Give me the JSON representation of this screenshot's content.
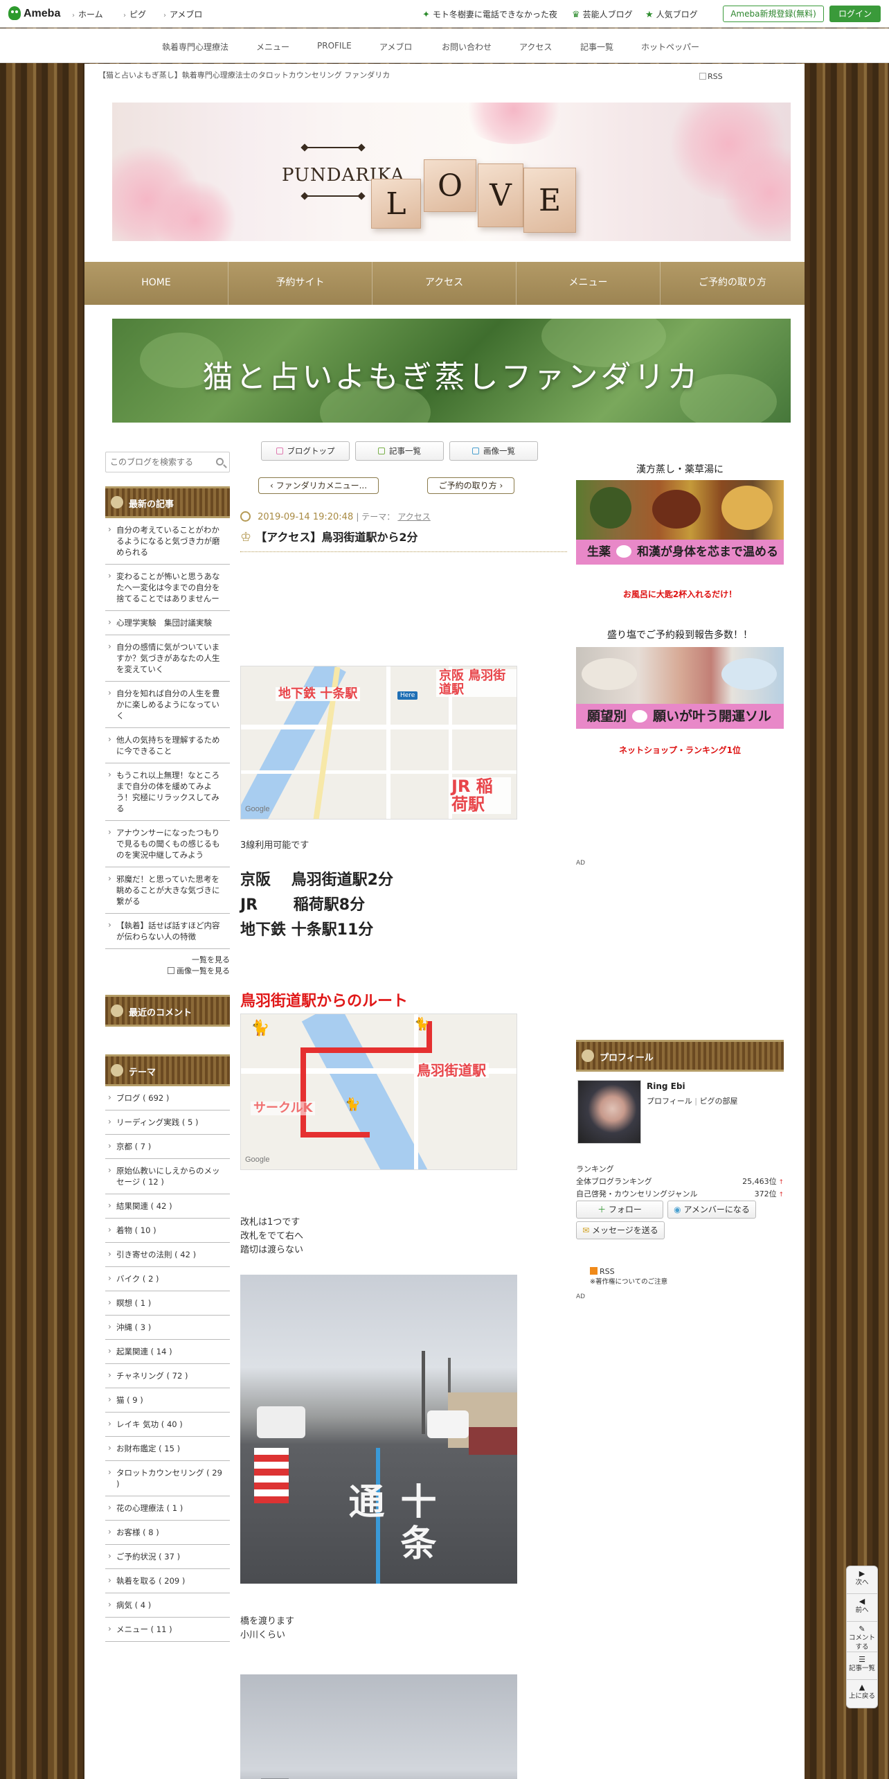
{
  "topbar": {
    "logo": "Ameba",
    "nav": [
      "ホーム",
      "ピグ",
      "アメブロ"
    ],
    "links": [
      "モト冬樹妻に電話できなかった夜",
      "芸能人ブログ",
      "人気ブログ"
    ],
    "register": "Ameba新規登録(無料)",
    "login": "ログイン"
  },
  "gnav": [
    "執着専門心理療法",
    "メニュー",
    "PROFILE",
    "アメブロ",
    "お問い合わせ",
    "アクセス",
    "記事一覧",
    "ホットペッパー"
  ],
  "header": {
    "title": "【猫と占いよもぎ蒸し】執着専門心理療法士のタロットカウンセリング ファンダリカ",
    "rss": "RSS",
    "brand": "PUNDARIKA",
    "love": [
      "L",
      "O",
      "V",
      "E"
    ]
  },
  "menubar": [
    "HOME",
    "予約サイト",
    "アクセス",
    "メニュー",
    "ご予約の取り方"
  ],
  "banner2": "猫と占いよもぎ蒸しファンダリカ",
  "left": {
    "search_placeholder": "このブログを検索する",
    "latest_heading": "最新の記事",
    "latest": [
      "自分の考えていることがわかるようになると気づき力が磨められる",
      "変わることが怖いと思うあなたへ一変化は今までの自分を捨てることではありませんー",
      "心理学実験　集団討議実験",
      "自分の感情に気がついていますか？気づきがあなたの人生を変えていく",
      "自分を知れば自分の人生を豊かに楽しめるようになっていく",
      "他人の気持ちを理解するために今できること",
      "もうこれ以上無理！なところまで自分の体を緩めてみよう！究極にリラックスしてみる",
      "アナウンサーになったつもりで見るもの聞くもの感じるものを実況中継してみよう",
      "邪魔だ！と思っていた思考を眺めることが大きな気づきに繋がる",
      "【執着】話せば話すほど内容が伝わらない人の特徴"
    ],
    "more_list": "一覧を見る",
    "more_images": "画像一覧を見る",
    "comments_heading": "最近のコメント",
    "theme_heading": "テーマ",
    "themes": [
      "ブログ ( 692 )",
      "リーディング実践 ( 5 )",
      "京都 ( 7 )",
      "原始仏教いにしえからのメッセージ ( 12 )",
      "結果関連 ( 42 )",
      "着物 ( 10 )",
      "引き寄せの法則 ( 42 )",
      "バイク ( 2 )",
      "瞑想 ( 1 )",
      "沖縄 ( 3 )",
      "起業関連 ( 14 )",
      "チャネリング ( 72 )",
      "猫 ( 9 )",
      "レイキ 気功 ( 40 )",
      "お財布鑑定 ( 15 )",
      "タロットカウンセリング ( 29 )",
      "花の心理療法 ( 1 )",
      "お客様 ( 8 )",
      "ご予約状況 ( 37 )",
      "執着を取る ( 209 )",
      "病気 ( 4 )",
      "メニュー ( 11 )"
    ]
  },
  "center": {
    "tabs": [
      "ブログトップ",
      "記事一覧",
      "画像一覧"
    ],
    "prev": "ファンダリカメニュー...",
    "next": "ご予約の取り方",
    "date": "2019-09-14 19:20:48",
    "theme_label": "テーマ：",
    "theme": "アクセス",
    "title": "【アクセス】鳥羽街道駅から2分",
    "map1_labels": [
      "地下鉄 十条駅",
      "京阪 鳥羽街道駅",
      "JR 稲荷駅",
      "Here",
      "Google"
    ],
    "line_info": "3線利用可能です",
    "stations": [
      "京阪　 鳥羽街道駅2分",
      "JR　　 稲荷駅8分",
      "地下鉄 十条駅11分"
    ],
    "route_heading": "鳥羽街道駅からのルート",
    "map2_labels": [
      "鳥羽街道駅",
      "サークルK",
      "Google"
    ],
    "exit_text": [
      "改札は1つです",
      "改札をでて右へ",
      "踏切は渡らない"
    ],
    "road_text": "十条通",
    "bridge_text": [
      "橋を渡ります",
      "小川くらい"
    ]
  },
  "right": {
    "kanpo_heading": "漢方蒸し・薬草湯に",
    "kanpo_banner": [
      "生薬",
      "和漢が身体を芯まで温める"
    ],
    "note1": "お風呂に大匙2杯入れるだけ！",
    "salt_heading": "盛り塩でご予約殺到報告多数！！",
    "salt_banner": [
      "願望別",
      "願いが叶う開運ソルト"
    ],
    "note2": "ネットショップ・ランキング1位",
    "ad1": "AD",
    "profile_heading": "プロフィール",
    "profile_name": "Ring Ebi",
    "profile_links": [
      "プロフィール",
      "ピグの部屋"
    ],
    "ranking_label": "ランキング",
    "ranking": [
      {
        "label": "全体ブログランキング",
        "value": "25,463位"
      },
      {
        "label": "自己啓発・カウンセリングジャンル",
        "value": "372位"
      }
    ],
    "follow": "フォロー",
    "member": "アメンバーになる",
    "message": "メッセージを送る",
    "rss": "RSS",
    "copyright": "※著作権についてのご注意",
    "ad2": "AD"
  },
  "floatnav": [
    {
      "icon": "▶",
      "label": "次へ"
    },
    {
      "icon": "◀",
      "label": "前へ"
    },
    {
      "icon": "",
      "label": "コメントする"
    },
    {
      "icon": "",
      "label": "記事一覧"
    },
    {
      "icon": "▲",
      "label": "上に戻る"
    }
  ]
}
